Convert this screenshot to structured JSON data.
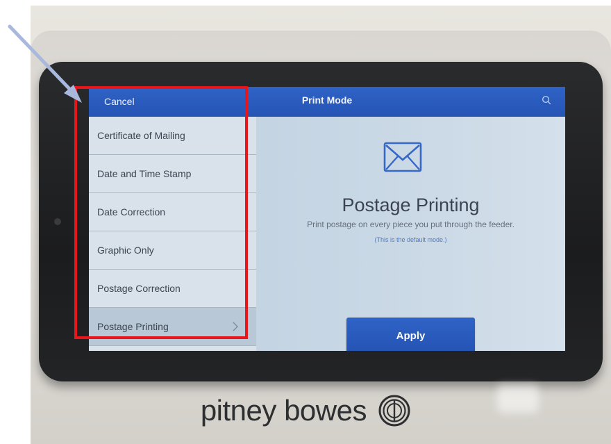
{
  "header": {
    "cancel_label": "Cancel",
    "title": "Print Mode",
    "search_icon": "search-icon"
  },
  "sidebar": {
    "items": [
      {
        "label": "Certificate of Mailing",
        "selected": false
      },
      {
        "label": "Date and Time Stamp",
        "selected": false
      },
      {
        "label": "Date Correction",
        "selected": false
      },
      {
        "label": "Graphic Only",
        "selected": false
      },
      {
        "label": "Postage Correction",
        "selected": false
      },
      {
        "label": "Postage Printing",
        "selected": true
      }
    ],
    "chevron_icon": "chevron-right-icon"
  },
  "main": {
    "icon": "envelope-icon",
    "title": "Postage Printing",
    "description": "Print postage on every piece you put through the feeder.",
    "note": "(This is the default mode.)",
    "apply_label": "Apply"
  },
  "brand": {
    "name": "pitney bowes",
    "logo_icon": "pitney-bowes-logo-icon"
  },
  "annotations": {
    "highlight_color": "#e8151b",
    "arrow_color": "#a9b9dd"
  },
  "colors": {
    "accent": "#2f63c6",
    "screen_bg": "#c9d7e4",
    "text": "#3c4652"
  }
}
